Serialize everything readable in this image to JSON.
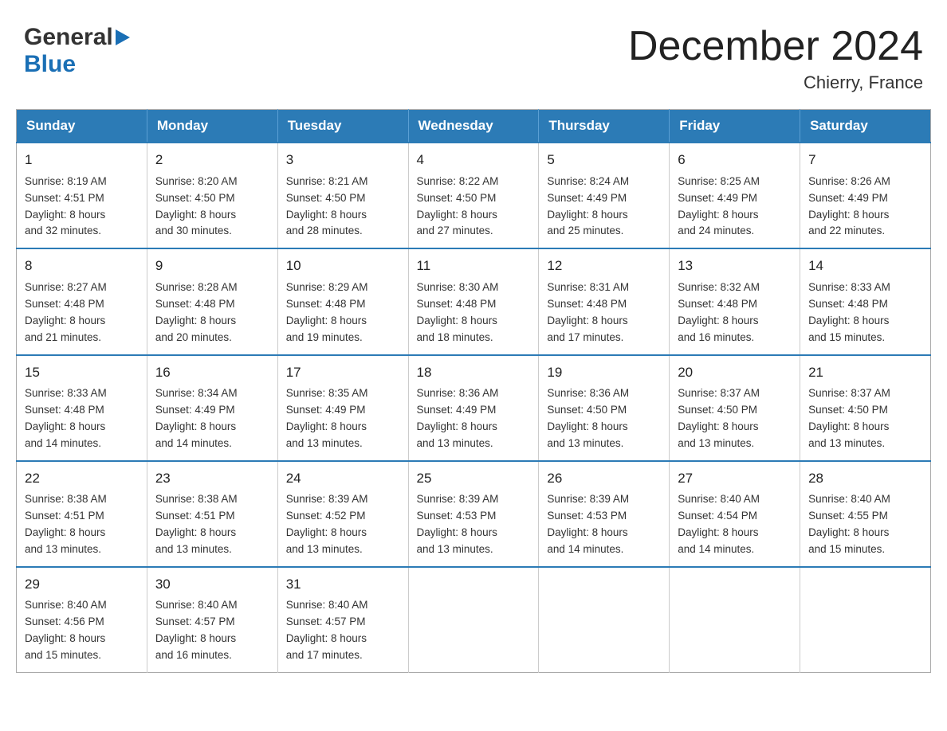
{
  "header": {
    "logo_general": "General",
    "logo_blue": "Blue",
    "month_title": "December 2024",
    "location": "Chierry, France"
  },
  "days_of_week": [
    "Sunday",
    "Monday",
    "Tuesday",
    "Wednesday",
    "Thursday",
    "Friday",
    "Saturday"
  ],
  "weeks": [
    [
      {
        "date": "1",
        "sunrise": "8:19 AM",
        "sunset": "4:51 PM",
        "daylight": "8 hours and 32 minutes."
      },
      {
        "date": "2",
        "sunrise": "8:20 AM",
        "sunset": "4:50 PM",
        "daylight": "8 hours and 30 minutes."
      },
      {
        "date": "3",
        "sunrise": "8:21 AM",
        "sunset": "4:50 PM",
        "daylight": "8 hours and 28 minutes."
      },
      {
        "date": "4",
        "sunrise": "8:22 AM",
        "sunset": "4:50 PM",
        "daylight": "8 hours and 27 minutes."
      },
      {
        "date": "5",
        "sunrise": "8:24 AM",
        "sunset": "4:49 PM",
        "daylight": "8 hours and 25 minutes."
      },
      {
        "date": "6",
        "sunrise": "8:25 AM",
        "sunset": "4:49 PM",
        "daylight": "8 hours and 24 minutes."
      },
      {
        "date": "7",
        "sunrise": "8:26 AM",
        "sunset": "4:49 PM",
        "daylight": "8 hours and 22 minutes."
      }
    ],
    [
      {
        "date": "8",
        "sunrise": "8:27 AM",
        "sunset": "4:48 PM",
        "daylight": "8 hours and 21 minutes."
      },
      {
        "date": "9",
        "sunrise": "8:28 AM",
        "sunset": "4:48 PM",
        "daylight": "8 hours and 20 minutes."
      },
      {
        "date": "10",
        "sunrise": "8:29 AM",
        "sunset": "4:48 PM",
        "daylight": "8 hours and 19 minutes."
      },
      {
        "date": "11",
        "sunrise": "8:30 AM",
        "sunset": "4:48 PM",
        "daylight": "8 hours and 18 minutes."
      },
      {
        "date": "12",
        "sunrise": "8:31 AM",
        "sunset": "4:48 PM",
        "daylight": "8 hours and 17 minutes."
      },
      {
        "date": "13",
        "sunrise": "8:32 AM",
        "sunset": "4:48 PM",
        "daylight": "8 hours and 16 minutes."
      },
      {
        "date": "14",
        "sunrise": "8:33 AM",
        "sunset": "4:48 PM",
        "daylight": "8 hours and 15 minutes."
      }
    ],
    [
      {
        "date": "15",
        "sunrise": "8:33 AM",
        "sunset": "4:48 PM",
        "daylight": "8 hours and 14 minutes."
      },
      {
        "date": "16",
        "sunrise": "8:34 AM",
        "sunset": "4:49 PM",
        "daylight": "8 hours and 14 minutes."
      },
      {
        "date": "17",
        "sunrise": "8:35 AM",
        "sunset": "4:49 PM",
        "daylight": "8 hours and 13 minutes."
      },
      {
        "date": "18",
        "sunrise": "8:36 AM",
        "sunset": "4:49 PM",
        "daylight": "8 hours and 13 minutes."
      },
      {
        "date": "19",
        "sunrise": "8:36 AM",
        "sunset": "4:50 PM",
        "daylight": "8 hours and 13 minutes."
      },
      {
        "date": "20",
        "sunrise": "8:37 AM",
        "sunset": "4:50 PM",
        "daylight": "8 hours and 13 minutes."
      },
      {
        "date": "21",
        "sunrise": "8:37 AM",
        "sunset": "4:50 PM",
        "daylight": "8 hours and 13 minutes."
      }
    ],
    [
      {
        "date": "22",
        "sunrise": "8:38 AM",
        "sunset": "4:51 PM",
        "daylight": "8 hours and 13 minutes."
      },
      {
        "date": "23",
        "sunrise": "8:38 AM",
        "sunset": "4:51 PM",
        "daylight": "8 hours and 13 minutes."
      },
      {
        "date": "24",
        "sunrise": "8:39 AM",
        "sunset": "4:52 PM",
        "daylight": "8 hours and 13 minutes."
      },
      {
        "date": "25",
        "sunrise": "8:39 AM",
        "sunset": "4:53 PM",
        "daylight": "8 hours and 13 minutes."
      },
      {
        "date": "26",
        "sunrise": "8:39 AM",
        "sunset": "4:53 PM",
        "daylight": "8 hours and 14 minutes."
      },
      {
        "date": "27",
        "sunrise": "8:40 AM",
        "sunset": "4:54 PM",
        "daylight": "8 hours and 14 minutes."
      },
      {
        "date": "28",
        "sunrise": "8:40 AM",
        "sunset": "4:55 PM",
        "daylight": "8 hours and 15 minutes."
      }
    ],
    [
      {
        "date": "29",
        "sunrise": "8:40 AM",
        "sunset": "4:56 PM",
        "daylight": "8 hours and 15 minutes."
      },
      {
        "date": "30",
        "sunrise": "8:40 AM",
        "sunset": "4:57 PM",
        "daylight": "8 hours and 16 minutes."
      },
      {
        "date": "31",
        "sunrise": "8:40 AM",
        "sunset": "4:57 PM",
        "daylight": "8 hours and 17 minutes."
      },
      null,
      null,
      null,
      null
    ]
  ],
  "labels": {
    "sunrise": "Sunrise: ",
    "sunset": "Sunset: ",
    "daylight": "Daylight: "
  }
}
